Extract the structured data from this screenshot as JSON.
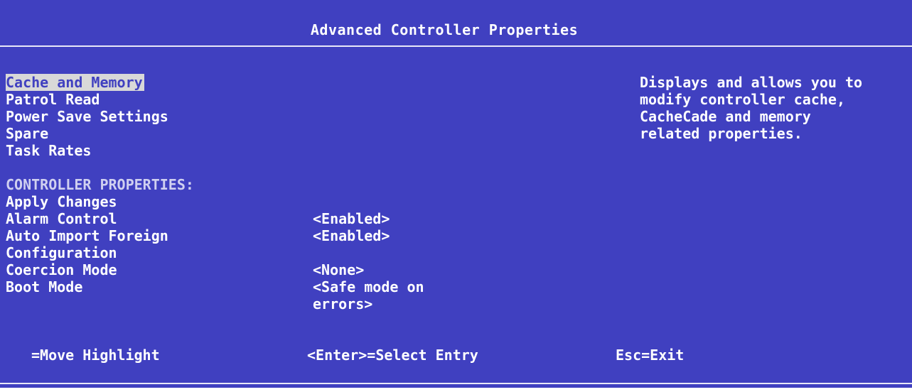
{
  "title": "Advanced Controller Properties",
  "menu": {
    "items": [
      {
        "label": "Cache and Memory",
        "selected": true
      },
      {
        "label": "Patrol Read"
      },
      {
        "label": "Power Save Settings"
      },
      {
        "label": "Spare"
      },
      {
        "label": "Task Rates"
      }
    ]
  },
  "controller_properties": {
    "heading": "CONTROLLER PROPERTIES:",
    "rows": [
      {
        "label": "Apply Changes",
        "value": ""
      },
      {
        "label": "Alarm Control",
        "value": "<Enabled>"
      },
      {
        "label": "Auto Import Foreign",
        "value": "<Enabled>"
      },
      {
        "label": "Configuration",
        "value": ""
      },
      {
        "label": "Coercion Mode",
        "value": "<None>"
      },
      {
        "label": "Boot Mode",
        "value": "<Safe mode on errors>"
      }
    ]
  },
  "help_text": "Displays and allows you to modify controller cache, CacheCade and memory related properties.",
  "footer": {
    "move": "=Move Highlight",
    "select": "<Enter>=Select Entry",
    "exit": "Esc=Exit"
  },
  "colors": {
    "background": "#4040c0",
    "text": "#ffffff",
    "highlight_bg": "#d8d8d8",
    "highlight_text": "#4040c0"
  }
}
